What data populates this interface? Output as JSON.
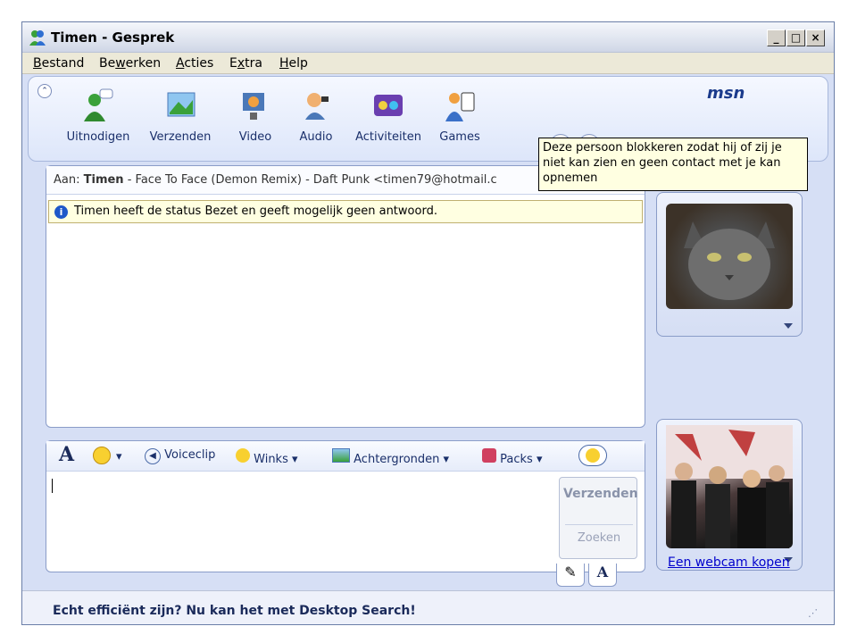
{
  "window": {
    "title": "Timen - Gesprek"
  },
  "menu": [
    {
      "pre": "",
      "u": "B",
      "post": "estand"
    },
    {
      "pre": "Be",
      "u": "w",
      "post": "erken"
    },
    {
      "pre": "",
      "u": "A",
      "post": "cties"
    },
    {
      "pre": "E",
      "u": "x",
      "post": "tra"
    },
    {
      "pre": "",
      "u": "H",
      "post": "elp"
    }
  ],
  "toolbar": {
    "buttons": [
      {
        "label": "Uitnodigen",
        "icon": "invite-icon"
      },
      {
        "label": "Verzenden",
        "icon": "send-file-icon"
      },
      {
        "label": "Video",
        "icon": "video-icon"
      },
      {
        "label": "Audio",
        "icon": "audio-icon"
      },
      {
        "label": "Activiteiten",
        "icon": "activities-icon"
      },
      {
        "label": "Games",
        "icon": "games-icon"
      }
    ],
    "logo": "msn"
  },
  "conversation": {
    "to_prefix": "Aan:",
    "to_name": "Timen",
    "to_rest": " - Face To Face (Demon Remix) - Daft Punk <timen79@hotmail.c",
    "status_message": "Timen heeft de status Bezet en geeft mogelijk geen antwoord."
  },
  "tooltip": "Deze persoon blokkeren zodat hij of zij je niet kan zien en geen contact met je kan opnemen",
  "format_bar": {
    "voiceclip": "Voiceclip",
    "winks": "Winks",
    "backgrounds": "Achtergronden",
    "packs": "Packs"
  },
  "compose": {
    "send_label": "Verzenden",
    "search_label": "Zoeken",
    "input_value": ""
  },
  "sidebar": {
    "webcam_link": "Een webcam kopen"
  },
  "footer": {
    "text": "Echt efficiënt zijn? Nu kan het met Desktop Search!"
  }
}
